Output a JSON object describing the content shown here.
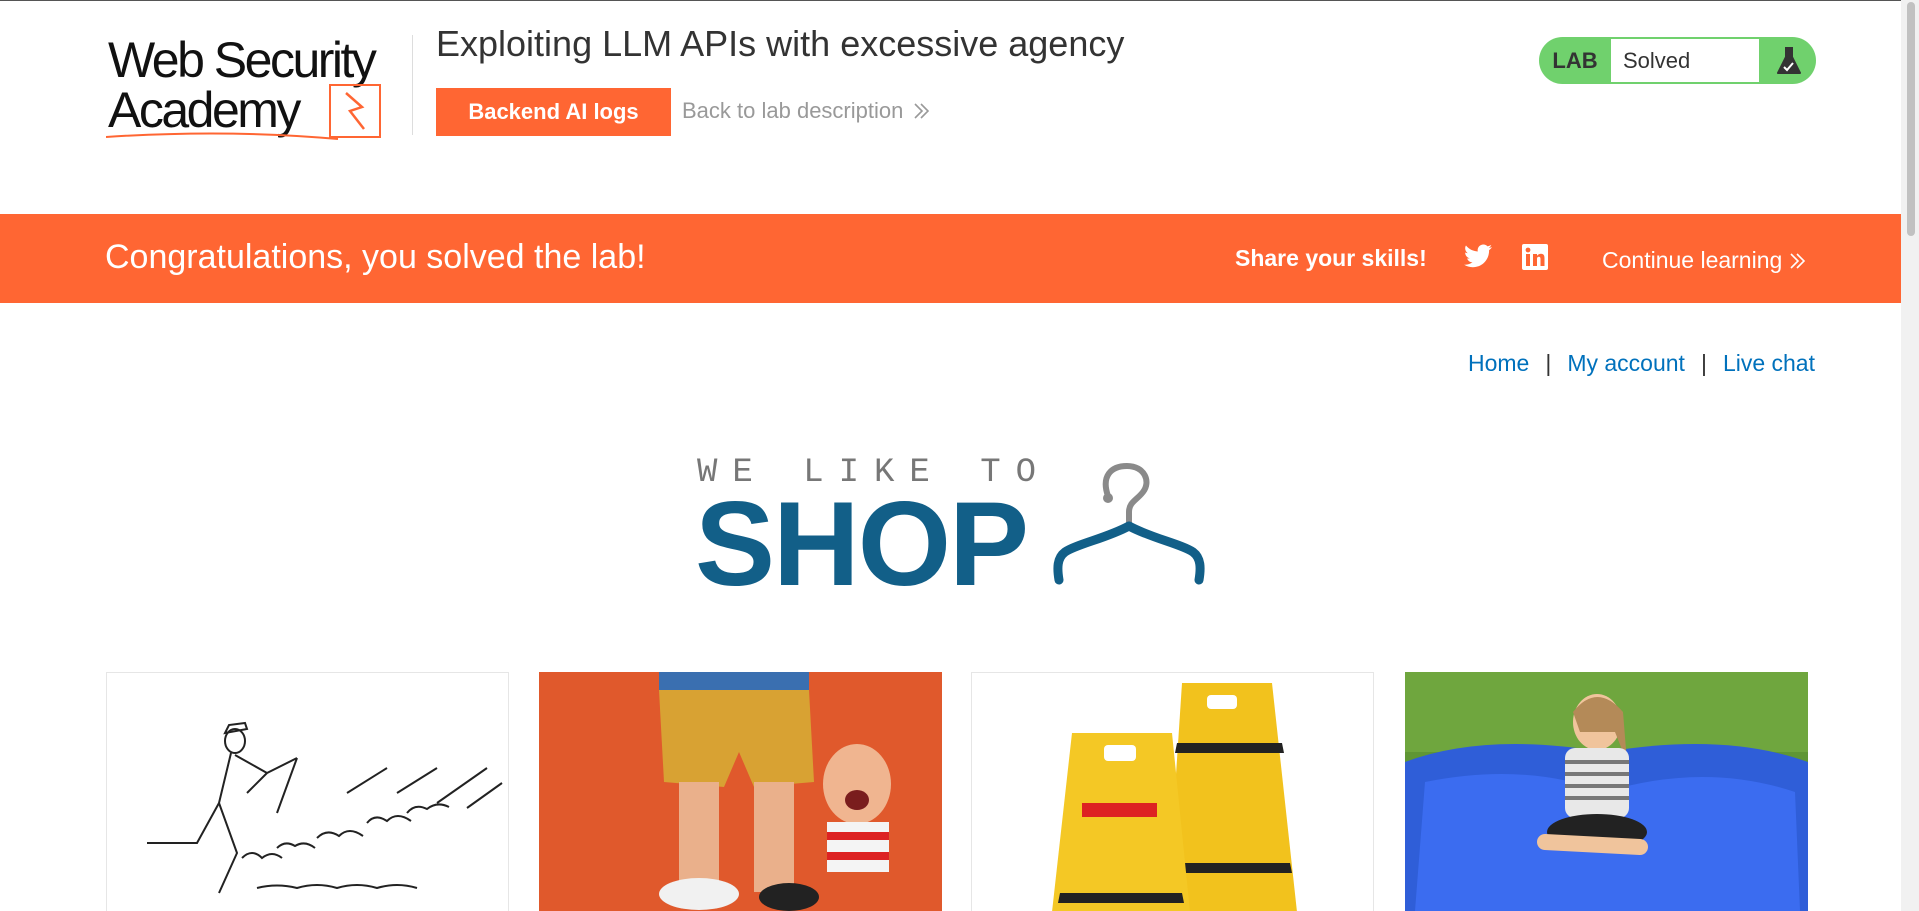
{
  "header": {
    "logo": {
      "line1": "Web Security",
      "line2": "Academy"
    },
    "lab_title": "Exploiting LLM APIs with excessive agency",
    "backend_button": "Backend AI logs",
    "back_link": "Back to lab description",
    "lab_badge": {
      "label": "LAB",
      "status": "Solved",
      "icon": "flask-icon"
    }
  },
  "banner": {
    "message": "Congratulations, you solved the lab!",
    "share": "Share your skills!",
    "continue": "Continue learning",
    "icons": [
      "twitter-icon",
      "linkedin-icon"
    ]
  },
  "nav": {
    "home": "Home",
    "account": "My account",
    "chat": "Live chat",
    "separator": "|"
  },
  "shop_logo": {
    "tagline": "WE LIKE TO",
    "word": "SHOP",
    "icon": "hanger-icon"
  },
  "products": [
    {
      "image": "running-man-sketch"
    },
    {
      "image": "figurine-child-leg"
    },
    {
      "image": "caution-signs"
    },
    {
      "image": "girl-on-beanbag"
    }
  ],
  "colors": {
    "accent": "#ff6633",
    "solved": "#70d16d",
    "link": "#0071bc",
    "shop": "#125f88"
  }
}
